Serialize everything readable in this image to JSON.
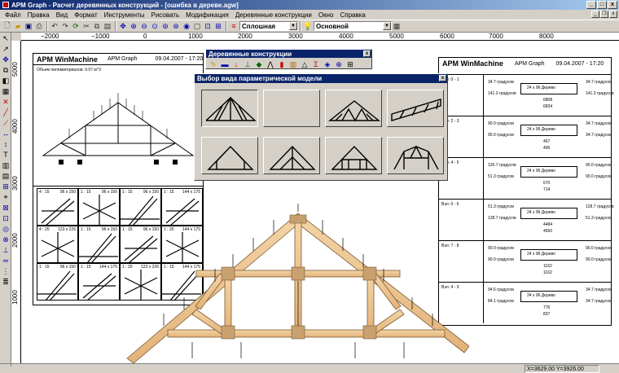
{
  "window": {
    "title": "APM Graph - Расчет деревянных конструкций - [ошибка в дереве.agw]",
    "min": "_",
    "max": "□",
    "close": "x"
  },
  "menu": [
    "Файл",
    "Правка",
    "Вид",
    "Формат",
    "Инструменты",
    "Рисовать",
    "Модификация",
    "Деревянные конструкции",
    "Окно",
    "Справка"
  ],
  "toolbar": {
    "linetype": "Сплошная",
    "layer": "Основной"
  },
  "ruler": {
    "top": [
      "−2000",
      "−1000",
      "0",
      "1000",
      "2000",
      "3000",
      "4000",
      "5000",
      "6000",
      "7000",
      "8000"
    ],
    "left": [
      "5000",
      "4000",
      "3000",
      "2000",
      "1000"
    ]
  },
  "sheet1": {
    "brand": "APM WinMachine",
    "app": "APM Graph",
    "date": "09.04.2007 - 17:20",
    "note": "Объем пиломатериалов: 0.07 м^3"
  },
  "sheet2": {
    "brand": "APM WinMachine",
    "app": "APM Graph",
    "date": "09.04.2007 - 17:20"
  },
  "grid_cells": [
    {
      "scale": "4 : 15",
      "size": "96 x 150"
    },
    {
      "scale": "1 : 15",
      "size": "96 x 150"
    },
    {
      "scale": "1 : 15",
      "size": "96 x 150"
    },
    {
      "scale": "1 : 15",
      "size": "144 x 175"
    },
    {
      "scale": "4 : 20",
      "size": "123 x 226"
    },
    {
      "scale": "1 : 15",
      "size": "96 x 150"
    },
    {
      "scale": "1 : 15",
      "size": "96 x 150"
    },
    {
      "scale": "1 : 20",
      "size": "144 x 175"
    },
    {
      "scale": "1 : 15",
      "size": "96 x 150"
    },
    {
      "scale": "1 : 15",
      "size": "144 x 175"
    },
    {
      "scale": "1 : 20",
      "size": "123 x 226"
    },
    {
      "scale": "1 : 15",
      "size": "144 x 175"
    }
  ],
  "right_rows": [
    {
      "label": "Вэл: 0 - 1",
      "a1": "34.7 градусов",
      "a2": "141.3 градусов",
      "b1": "34.7 градусов",
      "b2": "141.3 градусов",
      "beam": "24 x 96  Дерево",
      "d1": "6808",
      "d2": "6834"
    },
    {
      "label": "Вэл: 2 - 3",
      "a1": "90.0 градусов",
      "a2": "90.0 градусов",
      "b1": "34.7 градусов",
      "b2": "34.7 градусов",
      "beam": "24 x 96  Дерево",
      "d1": "467",
      "d2": "496"
    },
    {
      "label": "Вэл: 4 - 5",
      "a1": "126.7 градусов",
      "a2": "51.3 градусов",
      "b1": "90.0 градусов",
      "b2": "90.0 градусов",
      "beam": "24 x 96  Дерево",
      "d1": "670",
      "d2": "714"
    },
    {
      "label": "Вэл: 0 - 6",
      "a1": "51.3 градусов",
      "a2": "128.7 градусов",
      "b1": "128.7 градусов",
      "b2": "51.3 градусов",
      "beam": "24 x 96  Дерево",
      "d1": "4484",
      "d2": "4560"
    },
    {
      "label": "Вэл: 7 - 8",
      "a1": "90.0 градусов",
      "a2": "90.0 градусов",
      "b1": "90.0 градусов",
      "b2": "90.0 градусов",
      "beam": "24 x 96  Дерево",
      "d1": "1162",
      "d2": "1162"
    },
    {
      "label": "Вэл: 4 - 9",
      "a1": "94.6 градусов",
      "a2": "84.1 градусов",
      "b1": "34.7 градусов",
      "b2": "34.7 градусов",
      "beam": "24 x 96  Дерево",
      "d1": "776",
      "d2": "837"
    }
  ],
  "wood_toolbar": {
    "title": "Деревянные конструкции"
  },
  "dialog": {
    "title": "Выбор вида параметрической модели"
  },
  "status": {
    "coords": "X=3629.00 Y=3926.00"
  }
}
